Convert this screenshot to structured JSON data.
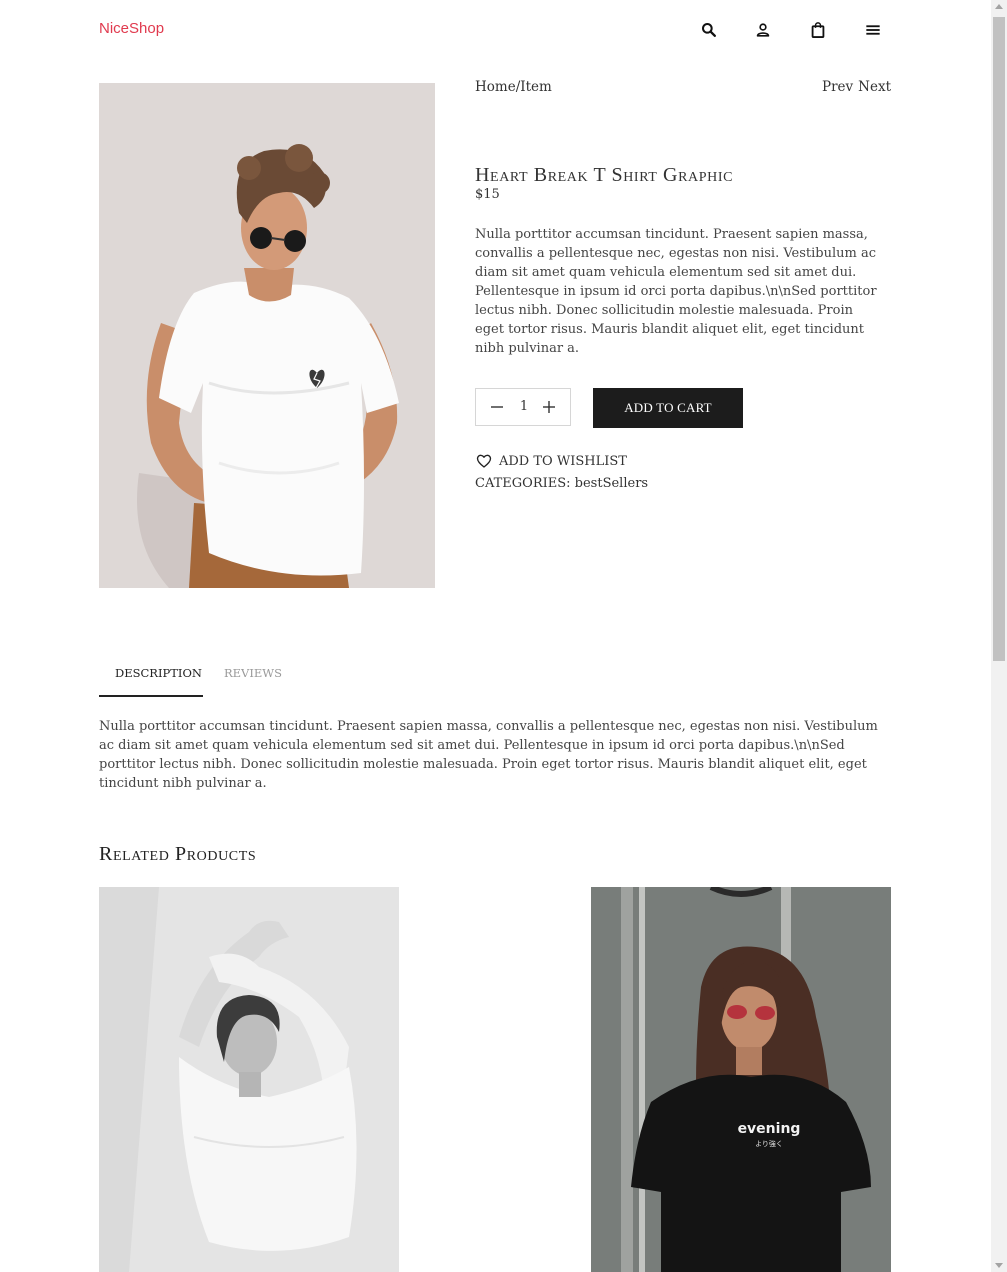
{
  "header": {
    "logo": "NiceShop",
    "icons": [
      "search-icon",
      "user-icon",
      "shopping-bag-icon",
      "menu-icon"
    ]
  },
  "breadcrumb": {
    "home": "Home",
    "separator": "/",
    "item": "Item"
  },
  "pager": {
    "prev": "Prev",
    "next": "Next"
  },
  "product": {
    "title": "Heart Break T Shirt Graphic",
    "price": "$15",
    "description": "Nulla porttitor accumsan tincidunt. Praesent sapien massa, convallis a pellentesque nec, egestas non nisi. Vestibulum ac diam sit amet quam vehicula elementum sed sit amet dui. Pellentesque in ipsum id orci porta dapibus.\\n\\nSed porttitor lectus nibh. Donec sollicitudin molestie malesuada. Proin eget tortor risus. Mauris blandit aliquet elit, eget tincidunt nibh pulvinar a.",
    "quantity": "1",
    "add_to_cart": "ADD TO CART",
    "wishlist": "ADD TO WISHLIST",
    "categories_label": "CATEGORIES:",
    "category": "bestSellers"
  },
  "tabs": [
    {
      "label": "DESCRIPTION",
      "active": true
    },
    {
      "label": "REVIEWS",
      "active": false
    }
  ],
  "tab_content": "Nulla porttitor accumsan tincidunt. Praesent sapien massa, convallis a pellentesque nec, egestas non nisi. Vestibulum ac diam sit amet quam vehicula elementum sed sit amet dui. Pellentesque in ipsum id orci porta dapibus.\\n\\nSed porttitor lectus nibh. Donec sollicitudin molestie malesuada. Proin eget tortor risus. Mauris blandit aliquet elit, eget tincidunt nibh pulvinar a.",
  "related": {
    "title": "Related Products",
    "shirt_print": "evening",
    "shirt_print_sub": "より強く"
  },
  "colors": {
    "brand": "#e03a4e",
    "button_bg": "#1c1c1c",
    "text": "#333333"
  }
}
